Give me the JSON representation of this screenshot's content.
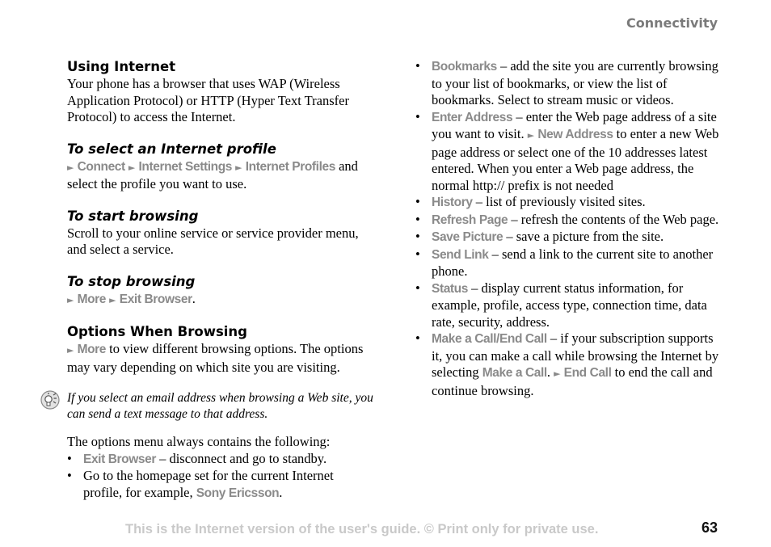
{
  "header": {
    "section": "Connectivity"
  },
  "left": {
    "using_internet": {
      "title": "Using Internet",
      "body": "Your phone has a browser that uses WAP (Wireless Application Protocol) or HTTP (Hyper Text Transfer Protocol) to access the Internet."
    },
    "select_profile": {
      "title": "To select an Internet profile",
      "path": [
        "Connect",
        "Internet Settings",
        "Internet Profiles"
      ],
      "suffix": " and select the profile you want to use."
    },
    "start_browsing": {
      "title": "To start browsing",
      "body": "Scroll to your online service or service provider menu, and select a service."
    },
    "stop_browsing": {
      "title": "To stop browsing",
      "path": [
        "More",
        "Exit Browser"
      ],
      "suffix": "."
    },
    "options": {
      "title": "Options When Browsing",
      "path": [
        "More"
      ],
      "suffix": " to view different browsing options. The options may vary depending on which site you are visiting."
    },
    "tip": {
      "icon": "lightbulb-tip-icon",
      "text": "If you select an email address when browsing a Web site, you can send a text message to that address."
    },
    "menu_intro": "The options menu always contains the following:",
    "menu_items": [
      {
        "keyword": "Exit Browser",
        "text": " – disconnect and go to standby."
      },
      {
        "keyword": "",
        "text": "Go to the homepage set for the current Internet profile, for example, ",
        "keyword_end": "Sony Ericsson",
        "end": "."
      }
    ]
  },
  "right": {
    "items": [
      {
        "keyword": "Bookmarks",
        "text": " – add the site you are currently browsing to your list of bookmarks, or view the list of bookmarks. Select to stream music or videos."
      },
      {
        "keyword": "Enter Address",
        "text": " – enter the Web page address of a site you want to visit. ",
        "path": "New Address",
        "text2": " to enter a new Web page address or select one of the 10 addresses latest entered. When you enter a Web page address, the normal http:// prefix is not needed"
      },
      {
        "keyword": "History",
        "text": " – list of previously visited sites."
      },
      {
        "keyword": "Refresh Page",
        "text": " – refresh the contents of the Web page."
      },
      {
        "keyword": "Save Picture",
        "text": " – save a picture from the site."
      },
      {
        "keyword": "Send Link",
        "text": " – send a link to the current site to another phone."
      },
      {
        "keyword": "Status",
        "text": " – display current status information, for example, profile, access type, connection time, data rate, security, address."
      },
      {
        "keyword": "Make a Call/End Call",
        "text": " – if your subscription supports it, you can make a call while browsing the Internet by selecting ",
        "kw2": "Make a Call",
        "text2": ". ",
        "path": "End Call",
        "text3": " to end the call and continue browsing."
      }
    ]
  },
  "footer": {
    "notice": "This is the Internet version of the user's guide. © Print only for private use.",
    "page_number": "63"
  },
  "glyphs": {
    "arrow": "►",
    "bullet": "•"
  }
}
